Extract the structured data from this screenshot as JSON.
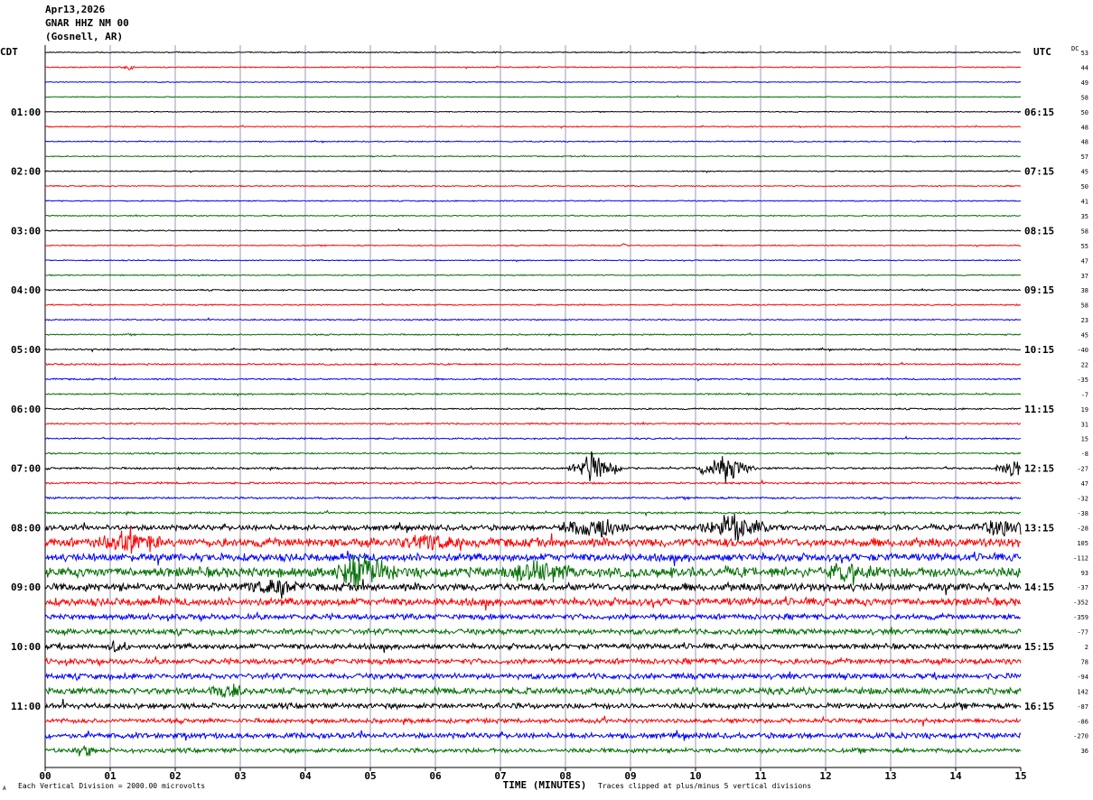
{
  "header": {
    "date": "Apr13,2026",
    "station": "GNAR HHZ NM 00",
    "location": "(Gosnell, AR)"
  },
  "axis_labels": {
    "left_tz": "CDT",
    "right_tz": "UTC",
    "dc_label": "DC",
    "x_title": "TIME (MINUTES)"
  },
  "footer": {
    "scale_note": "Each Vertical Division = 2000.00 microvolts",
    "clip_note": "Traces clipped at plus/minus 5 vertical divisions",
    "corner_mark": "A"
  },
  "colors": {
    "trace_cycle": [
      "#000000",
      "#ff0000",
      "#0000ff",
      "#007000"
    ],
    "gridline": "#8080a0",
    "background": "#ffffff"
  },
  "chart_data": {
    "type": "line",
    "title": "Apr13,2026 GNAR HHZ NM 00 (Gosnell, AR)",
    "xlabel": "TIME (MINUTES)",
    "xlim": [
      0,
      15
    ],
    "x_ticks": [
      "00",
      "01",
      "02",
      "03",
      "04",
      "05",
      "06",
      "07",
      "08",
      "09",
      "10",
      "11",
      "12",
      "13",
      "14",
      "15"
    ],
    "left_ticks": [
      {
        "row": 4,
        "label": "01:00"
      },
      {
        "row": 8,
        "label": "02:00"
      },
      {
        "row": 12,
        "label": "03:00"
      },
      {
        "row": 16,
        "label": "04:00"
      },
      {
        "row": 20,
        "label": "05:00"
      },
      {
        "row": 24,
        "label": "06:00"
      },
      {
        "row": 28,
        "label": "07:00"
      },
      {
        "row": 32,
        "label": "08:00"
      },
      {
        "row": 36,
        "label": "09:00"
      },
      {
        "row": 40,
        "label": "10:00"
      },
      {
        "row": 44,
        "label": "11:00"
      }
    ],
    "right_ticks": [
      {
        "row": 4,
        "label": "06:15"
      },
      {
        "row": 8,
        "label": "07:15"
      },
      {
        "row": 12,
        "label": "08:15"
      },
      {
        "row": 16,
        "label": "09:15"
      },
      {
        "row": 20,
        "label": "10:15"
      },
      {
        "row": 24,
        "label": "11:15"
      },
      {
        "row": 28,
        "label": "12:15"
      },
      {
        "row": 32,
        "label": "13:15"
      },
      {
        "row": 36,
        "label": "14:15"
      },
      {
        "row": 40,
        "label": "15:15"
      },
      {
        "row": 44,
        "label": "16:15"
      }
    ],
    "dc_offsets": [
      "53",
      "44",
      "49",
      "58",
      "50",
      "48",
      "48",
      "57",
      "45",
      "50",
      "41",
      "35",
      "58",
      "55",
      "47",
      "37",
      "38",
      "58",
      "23",
      "45",
      "-40",
      "22",
      "-35",
      "-7",
      "19",
      "31",
      "15",
      "-8",
      "-27",
      "47",
      "-32",
      "-38",
      "-28",
      "105",
      "-112",
      "93",
      "-37",
      "-352",
      "-359",
      "-77",
      "2",
      "78",
      "-94",
      "142",
      "-87",
      "-86",
      "-270",
      "36"
    ],
    "trace_rows": 48,
    "minutes_per_row": 15,
    "noise_level": [
      0.5,
      0.5,
      0.4,
      0.4,
      0.4,
      0.5,
      0.5,
      0.5,
      0.5,
      0.5,
      0.5,
      0.5,
      0.5,
      0.5,
      0.5,
      0.5,
      0.6,
      0.6,
      0.6,
      0.6,
      0.7,
      0.7,
      0.7,
      0.7,
      0.7,
      0.7,
      0.7,
      0.7,
      0.9,
      0.9,
      0.9,
      0.9,
      2.5,
      4.0,
      3.5,
      4.5,
      3.5,
      3.5,
      2.5,
      2.5,
      2.5,
      2.5,
      2.5,
      3.0,
      2.5,
      2.0,
      2.5,
      2.0
    ],
    "events": [
      {
        "row": 1,
        "minute": 1.3,
        "amplitude": 3,
        "duration": 0.1
      },
      {
        "row": 13,
        "minute": 8.9,
        "amplitude": 3,
        "duration": 0.1
      },
      {
        "row": 28,
        "minute": 8.45,
        "amplitude": 15,
        "duration": 0.45
      },
      {
        "row": 28,
        "minute": 10.45,
        "amplitude": 14,
        "duration": 0.5
      },
      {
        "row": 28,
        "minute": 14.85,
        "amplitude": 10,
        "duration": 0.3
      },
      {
        "row": 32,
        "minute": 8.4,
        "amplitude": 12,
        "duration": 0.6
      },
      {
        "row": 32,
        "minute": 10.6,
        "amplitude": 12,
        "duration": 0.6
      },
      {
        "row": 32,
        "minute": 14.7,
        "amplitude": 12,
        "duration": 0.5
      },
      {
        "row": 33,
        "minute": 1.3,
        "amplitude": 9,
        "duration": 0.6
      },
      {
        "row": 33,
        "minute": 5.9,
        "amplitude": 7,
        "duration": 0.5
      },
      {
        "row": 35,
        "minute": 4.9,
        "amplitude": 18,
        "duration": 0.5
      },
      {
        "row": 35,
        "minute": 7.6,
        "amplitude": 10,
        "duration": 0.6
      },
      {
        "row": 35,
        "minute": 12.4,
        "amplitude": 8,
        "duration": 0.5
      },
      {
        "row": 36,
        "minute": 3.5,
        "amplitude": 6,
        "duration": 0.6
      },
      {
        "row": 40,
        "minute": 1.1,
        "amplitude": 6,
        "duration": 0.2
      },
      {
        "row": 43,
        "minute": 2.8,
        "amplitude": 6,
        "duration": 0.3
      },
      {
        "row": 47,
        "minute": 0.6,
        "amplitude": 6,
        "duration": 0.2
      }
    ]
  }
}
